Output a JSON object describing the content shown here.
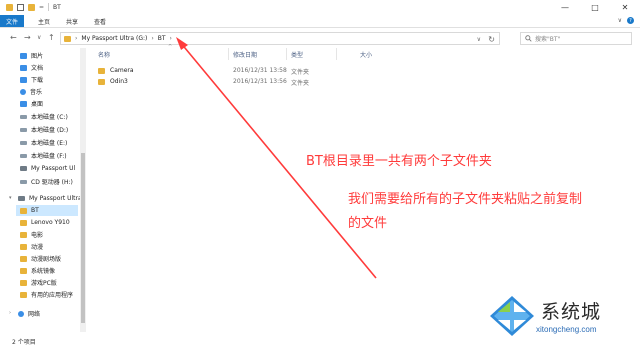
{
  "window": {
    "title": "BT",
    "quick_access_arrow": "=",
    "controls": [
      "—",
      "□",
      "✕"
    ]
  },
  "ribbon": {
    "tabs": [
      "文件",
      "主页",
      "共享",
      "查看"
    ],
    "collapse_glyph": "∨",
    "help_glyph": "?"
  },
  "address": {
    "crumbs": [
      "My Passport Ultra (G:)",
      "BT"
    ],
    "separator": "›",
    "search_placeholder": "搜索\"BT\"",
    "back": "←",
    "forward": "→",
    "history": "∨",
    "up": "↑",
    "dropdown": "∨",
    "refresh": "↻"
  },
  "sidebar": {
    "items": [
      {
        "label": "图片",
        "icon": "pictures-icon"
      },
      {
        "label": "文档",
        "icon": "documents-icon"
      },
      {
        "label": "下载",
        "icon": "downloads-icon"
      },
      {
        "label": "音乐",
        "icon": "music-icon"
      },
      {
        "label": "桌面",
        "icon": "desktop-icon"
      },
      {
        "label": "本地磁盘 (C:)",
        "icon": "drive-icon"
      },
      {
        "label": "本地磁盘 (D:)",
        "icon": "drive-icon"
      },
      {
        "label": "本地磁盘 (E:)",
        "icon": "drive-icon"
      },
      {
        "label": "本地磁盘 (F:)",
        "icon": "drive-icon"
      },
      {
        "label": "My Passport Ul",
        "icon": "usb-drive-icon"
      },
      {
        "label": "CD 驱动器 (H:)",
        "icon": "cd-drive-icon"
      },
      {
        "label": "My Passport Ultra",
        "icon": "usb-drive-icon"
      },
      {
        "label": "BT",
        "icon": "folder-icon"
      },
      {
        "label": "Lenovo Y910",
        "icon": "folder-icon"
      },
      {
        "label": "电影",
        "icon": "folder-icon"
      },
      {
        "label": "动漫",
        "icon": "folder-icon"
      },
      {
        "label": "动漫剧场版",
        "icon": "folder-icon"
      },
      {
        "label": "系统镜像",
        "icon": "folder-icon"
      },
      {
        "label": "游戏PC版",
        "icon": "folder-icon"
      },
      {
        "label": "有用的应用程序",
        "icon": "folder-icon"
      },
      {
        "label": "网络",
        "icon": "network-icon"
      }
    ]
  },
  "table": {
    "columns": [
      "名称",
      "修改日期",
      "类型",
      "大小"
    ],
    "sort_glyph": "^",
    "rows": [
      {
        "name": "Camera",
        "date": "2016/12/31 13:58",
        "type": "文件夹",
        "size": ""
      },
      {
        "name": "Odin3",
        "date": "2016/12/31 13:56",
        "type": "文件夹",
        "size": ""
      }
    ]
  },
  "annotations": {
    "note1": "BT根目录里一共有两个子文件夹",
    "note2_line1": "我们需要给所有的子文件夹粘贴之前复制",
    "note2_line2": "的文件",
    "color": "#ff3b3b"
  },
  "status": {
    "item_count": "2 个项目"
  },
  "watermark": {
    "brand": "系统城",
    "domain": "xitongcheng.com"
  },
  "colors": {
    "accent": "#1979ca",
    "folder": "#e8b33a",
    "selection": "#cce8ff"
  }
}
